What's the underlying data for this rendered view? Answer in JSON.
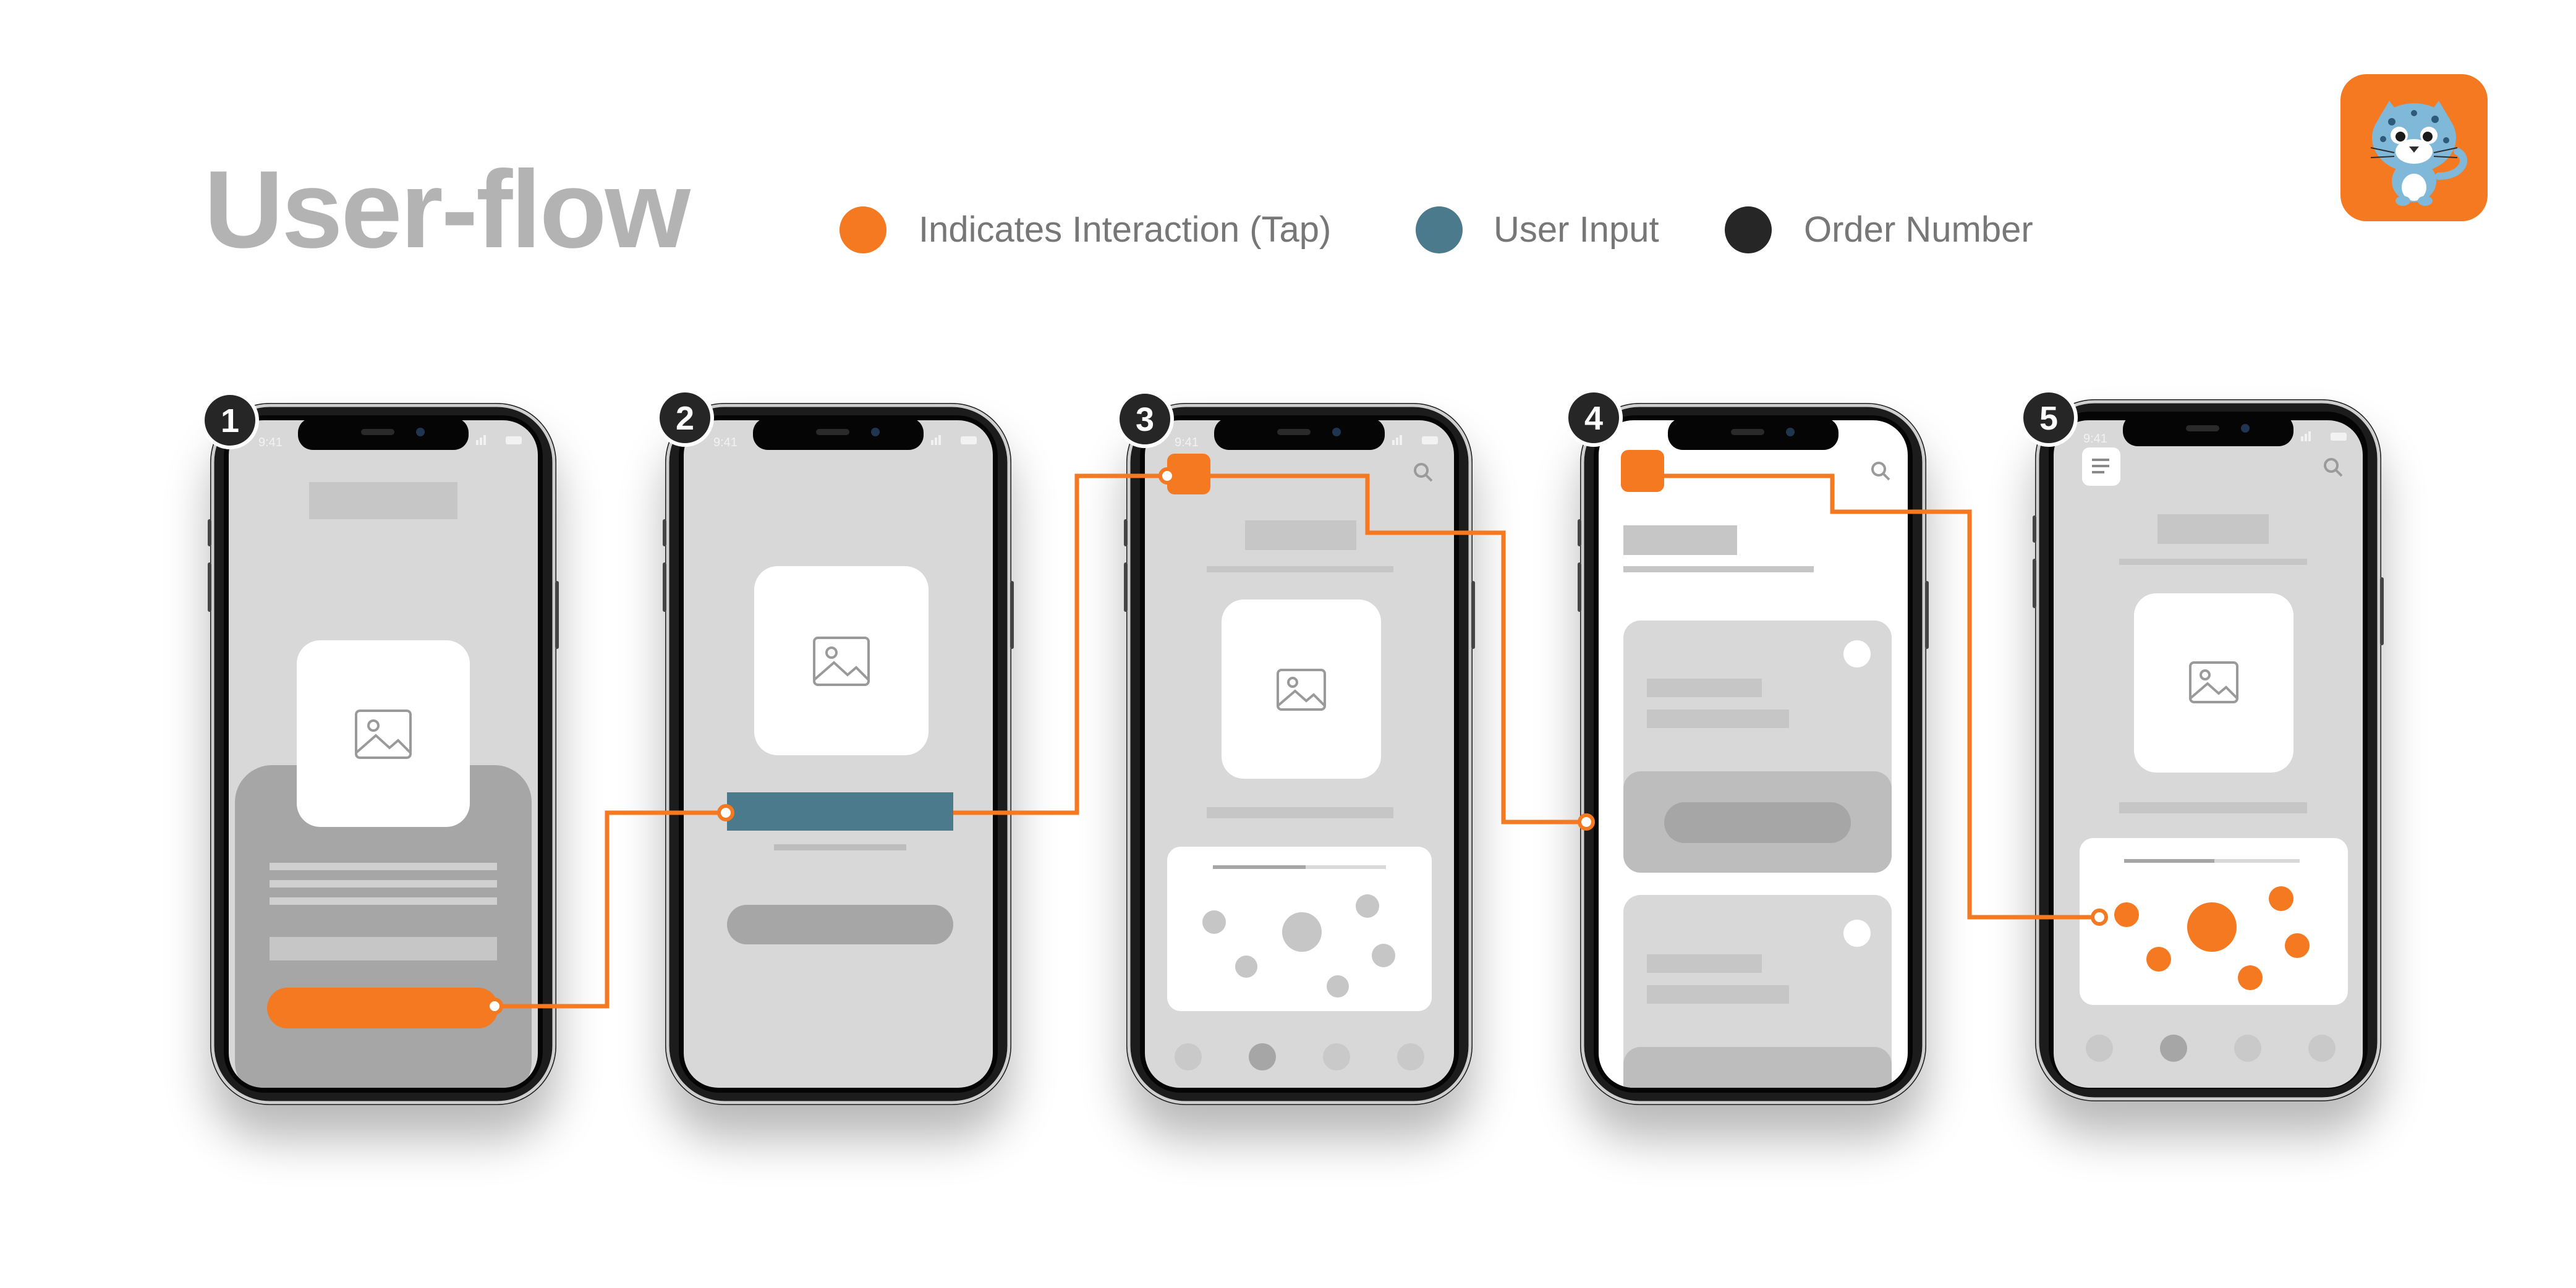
{
  "header": {
    "title": "User-flow"
  },
  "legend": [
    {
      "label": "Indicates Interaction (Tap)",
      "color": "#f47920"
    },
    {
      "label": "User Input",
      "color": "#4a7a8c"
    },
    {
      "label": "Order Number",
      "color": "#262626"
    }
  ],
  "colors": {
    "accent": "#f47920",
    "input": "#4a7a8c",
    "order": "#262626",
    "screen_bg": "#d8d8d8",
    "screen_bg_light": "#ffffff",
    "wire_dark": "#a6a6a6",
    "wire_mid": "#bdbdbd",
    "wire_light": "#c9c9c9"
  },
  "logo": {
    "icon": "snow-leopard-mascot-icon"
  },
  "steps": [
    {
      "number": "1",
      "status_time": "9:41"
    },
    {
      "number": "2",
      "status_time": "9:41"
    },
    {
      "number": "3",
      "status_time": "9:41"
    },
    {
      "number": "4",
      "status_time": "9:41"
    },
    {
      "number": "5",
      "status_time": "9:41"
    }
  ]
}
